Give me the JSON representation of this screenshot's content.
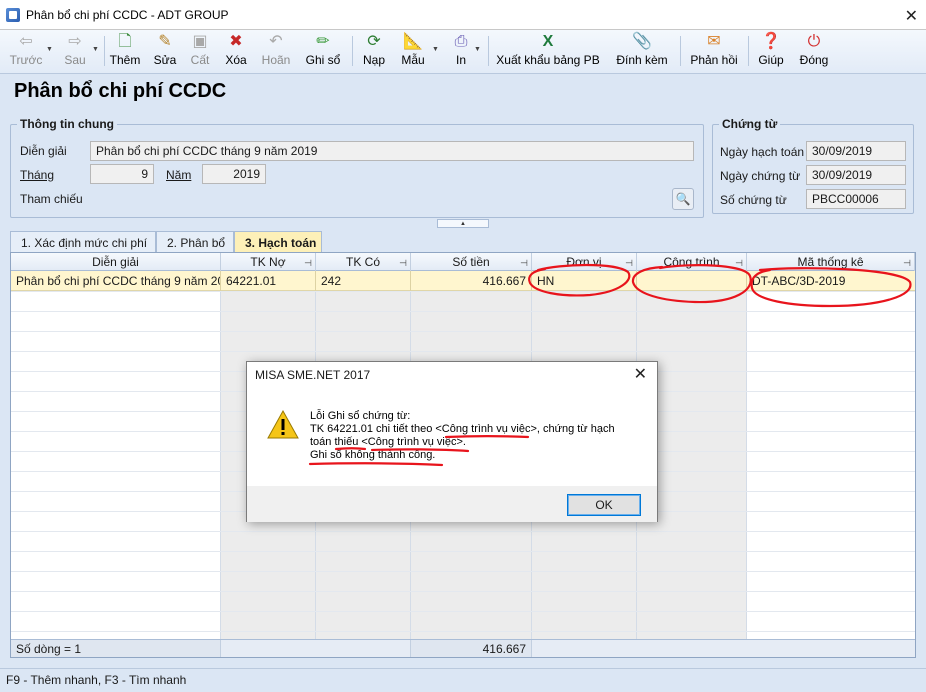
{
  "window": {
    "title": "Phân bổ chi phí CCDC - ADT GROUP",
    "close": "✕"
  },
  "toolbar": {
    "prev": "Trước",
    "next": "Sau",
    "add": "Thêm",
    "edit": "Sửa",
    "save": "Cất",
    "delete": "Xóa",
    "undo": "Hoãn",
    "post": "Ghi sổ",
    "load": "Nạp",
    "template": "Mẫu",
    "print": "In",
    "export": "Xuất khẩu bảng PB",
    "attach": "Đính kèm",
    "feedback": "Phản hồi",
    "help": "Giúp",
    "close": "Đóng"
  },
  "page_title": "Phân bổ chi phí CCDC",
  "general_info": {
    "title": "Thông tin chung",
    "description_label": "Diễn giải",
    "description_value": "Phân bổ chi phí CCDC tháng 9 năm 2019",
    "month_label": "Tháng",
    "month_value": "9",
    "year_label": "Năm",
    "year_value": "2019",
    "reference_label": "Tham chiếu"
  },
  "voucher": {
    "title": "Chứng từ",
    "posting_date_label": "Ngày hạch toán",
    "posting_date_value": "30/09/2019",
    "voucher_date_label": "Ngày chứng từ",
    "voucher_date_value": "30/09/2019",
    "voucher_no_label": "Số chứng từ",
    "voucher_no_value": "PBCC00006"
  },
  "tabs": [
    "1. Xác định mức chi phí",
    "2. Phân bổ",
    "3. Hạch toán"
  ],
  "grid": {
    "columns": [
      "Diễn giải",
      "TK Nợ",
      "TK Có",
      "Số tiền",
      "Đơn vị",
      "Công trình",
      "Mã thống kê"
    ],
    "rows": [
      {
        "description": "Phân bổ chi phí CCDC tháng 9 năm 20",
        "debit": "64221.01",
        "credit": "242",
        "amount": "416.667",
        "unit": "HN",
        "project": "",
        "stat_code": "DT-ABC/3D-2019"
      }
    ],
    "footer_count": "Số dòng = 1",
    "footer_total": "416.667"
  },
  "status_bar": "F9 - Thêm nhanh, F3 - Tìm nhanh",
  "dialog": {
    "title": "MISA SME.NET 2017",
    "close": "✕",
    "line1": "Lỗi Ghi sổ chứng từ:",
    "line2": "TK 64221.01 chi tiết theo <Công trình vụ việc>, chứng từ hạch",
    "line3": "toán thiếu <Công trình vụ việc>.",
    "line4": "Ghi sổ không thành công.",
    "ok": "OK"
  },
  "colors": {
    "active_tab": "#fdf0b8",
    "annotation": "#e8141c",
    "background": "#dbe6f4"
  }
}
